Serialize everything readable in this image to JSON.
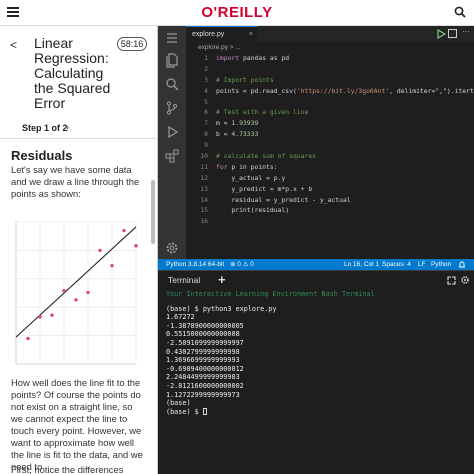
{
  "header": {
    "brand": "O'REILLY"
  },
  "lesson": {
    "title": "Linear Regression: Calculating the Squared Error",
    "timer": "58:16",
    "step_label": "Step 1 of 2",
    "step_next": "›",
    "section_heading": "Residuals",
    "para1": "Let's say we have some data and we draw a line through the points as shown:",
    "para2": "How well does the line fit to the points? Of course the points do not exist on a straight line, so we cannot expect the line to touch every point. However, we want to approximate how well the line is fit to the data, and we need to",
    "para3": "First, notice the differences"
  },
  "editor": {
    "tab_label": "explore.py",
    "tab_close": "×",
    "more": "···",
    "breadcrumb": "explore.py > ...",
    "line_numbers": [
      "1",
      "2",
      "3",
      "4",
      "5",
      "6",
      "7",
      "8",
      "9",
      "10",
      "11",
      "12",
      "13",
      "14",
      "15",
      "16"
    ],
    "lines": [
      {
        "kw": "import",
        "text": " pandas as pd"
      },
      {
        "text": ""
      },
      {
        "comment": "# Import points"
      },
      {
        "pre": "points = pd.read_csv(",
        "str": "'https://bit.ly/3go0Ant'",
        "post": ", delimiter=\",\").itertuples()"
      },
      {
        "text": ""
      },
      {
        "comment": "# Test with a given line"
      },
      {
        "pre": "m = ",
        "num": "1.93939"
      },
      {
        "pre": "b = ",
        "num": "4.73333"
      },
      {
        "text": ""
      },
      {
        "comment": "# calculate sum of squares"
      },
      {
        "kw": "for",
        "text": " p in points:"
      },
      {
        "text": "    y_actual = p.y"
      },
      {
        "text": "    y_predict = m*p.x + b"
      },
      {
        "text": "    residual = y_predict - y_actual"
      },
      {
        "text": "    print(residual)"
      },
      {
        "text": ""
      }
    ]
  },
  "status_bar": {
    "python": "Python 3.8.14 64-bit",
    "problems": "⊗ 0 ⚠ 0",
    "position": "Ln 16, Col 1",
    "spaces": "Spaces: 4",
    "eol": "LF",
    "lang": "Python"
  },
  "terminal": {
    "tab_label": "Terminal",
    "add_label": "+",
    "banner": "Your Interactive Learning Environment Bash Terminal",
    "lines": [
      "(base) $ python3 explore.py",
      "1.67272",
      "-1.3878900000000005",
      "0.5515000000000008",
      "-2.5091099999999997",
      "0.4302799999999998",
      "1.3696699999999993",
      "-0.6909400000000012",
      "2.2484499999999983",
      "-2.8121600000000002",
      "1.1272299999999973",
      "(base)"
    ],
    "prompt": "(base) $ "
  },
  "chart_data": {
    "type": "scatter",
    "title": "",
    "xlabel": "",
    "ylabel": "",
    "grid": true,
    "xlim": [
      0,
      10
    ],
    "ylim": [
      0,
      25
    ],
    "x": [
      1,
      2,
      3,
      4,
      5,
      6,
      7,
      8,
      9,
      10
    ],
    "y": [
      4.5,
      8.3,
      8.6,
      12.9,
      11.3,
      12.6,
      20.0,
      17.3,
      23.5,
      20.8
    ],
    "series": [
      {
        "type": "line",
        "slope": 1.93939,
        "intercept": 4.73333
      }
    ],
    "colors": {
      "points": "#e0446a",
      "line": "#222222"
    }
  }
}
